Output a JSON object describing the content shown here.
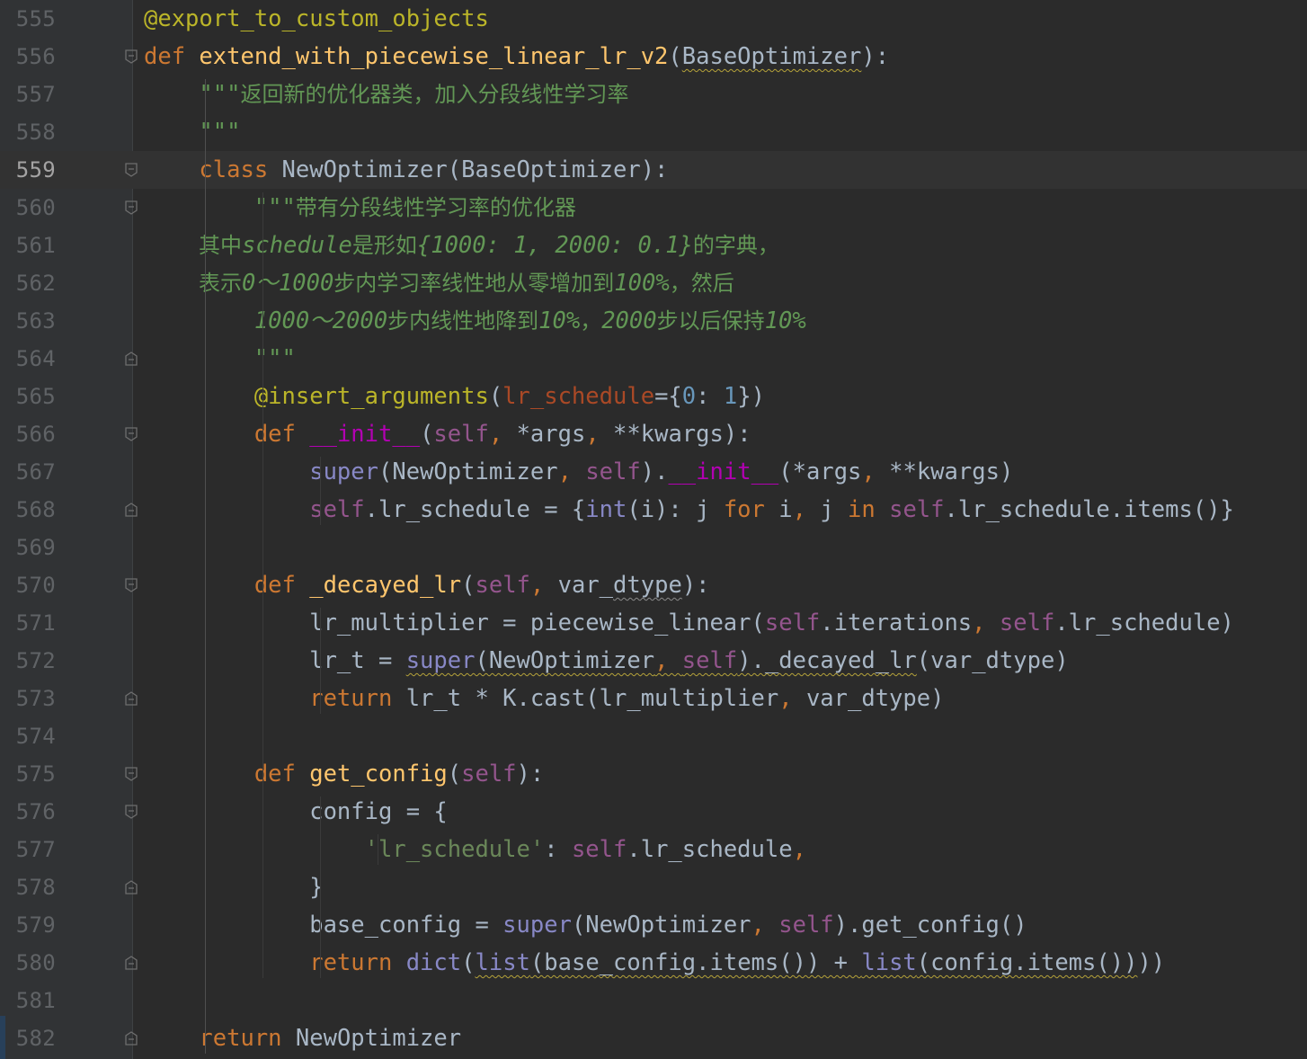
{
  "editor": {
    "language": "python",
    "current_line": 559,
    "colors": {
      "background": "#2b2b2b",
      "gutter": "#313335",
      "keyword": "#cc7832",
      "function": "#ffc66d",
      "decorator": "#bbb529",
      "self": "#94558d",
      "builtin": "#8888c6",
      "number": "#6897bb",
      "string": "#6a8759",
      "docstring": "#629755"
    }
  },
  "lines": [
    {
      "n": "555",
      "tokens": [
        [
          "dec",
          "@export_to_custom_objects"
        ]
      ]
    },
    {
      "n": "556",
      "tokens": [
        [
          "kw",
          "def "
        ],
        [
          "fn",
          "extend_with_piecewise_linear_lr_v2"
        ],
        [
          "",
          "("
        ],
        [
          "wavy",
          "BaseOptimizer"
        ],
        [
          "",
          "):"
        ]
      ]
    },
    {
      "n": "557",
      "tokens": [
        [
          "doc",
          "    \"\"\""
        ],
        [
          "doc-cn",
          "返回新的优化器类，加入分段线性学习率"
        ]
      ]
    },
    {
      "n": "558",
      "tokens": [
        [
          "doc",
          "    \"\"\""
        ]
      ]
    },
    {
      "n": "559",
      "tokens": [
        [
          "kw",
          "    class "
        ],
        [
          "",
          "NewOptimizer(BaseOptimizer):"
        ]
      ]
    },
    {
      "n": "560",
      "tokens": [
        [
          "doc",
          "        \"\"\""
        ],
        [
          "doc-cn",
          "带有分段线性学习率的优化器"
        ]
      ]
    },
    {
      "n": "561",
      "tokens": [
        [
          "doc-cn",
          "        其中"
        ],
        [
          "doc-it",
          "schedule"
        ],
        [
          "doc-cn",
          "是形如"
        ],
        [
          "doc-it",
          "{1000: 1, 2000: 0.1}"
        ],
        [
          "doc-cn",
          "的字典，"
        ]
      ]
    },
    {
      "n": "562",
      "tokens": [
        [
          "doc-cn",
          "        表示"
        ],
        [
          "doc-it",
          "0～1000"
        ],
        [
          "doc-cn",
          "步内学习率线性地从零增加到"
        ],
        [
          "doc-it",
          "100%"
        ],
        [
          "doc-cn",
          "，然后"
        ]
      ]
    },
    {
      "n": "563",
      "tokens": [
        [
          "doc-it",
          "        1000～2000"
        ],
        [
          "doc-cn",
          "步内线性地降到"
        ],
        [
          "doc-it",
          "10%"
        ],
        [
          "doc-cn",
          "，"
        ],
        [
          "doc-it",
          "2000"
        ],
        [
          "doc-cn",
          "步以后保持"
        ],
        [
          "doc-it",
          "10%"
        ]
      ]
    },
    {
      "n": "564",
      "tokens": [
        [
          "doc",
          "        \"\"\""
        ]
      ]
    },
    {
      "n": "565",
      "tokens": [
        [
          "dec",
          "        @insert_arguments"
        ],
        [
          "",
          "("
        ],
        [
          "param",
          "lr_schedule"
        ],
        [
          "",
          "={"
        ],
        [
          "num",
          "0"
        ],
        [
          "",
          ": "
        ],
        [
          "num",
          "1"
        ],
        [
          "",
          "})"
        ]
      ]
    },
    {
      "n": "566",
      "tokens": [
        [
          "kw",
          "        def "
        ],
        [
          "magic",
          "__init__"
        ],
        [
          "",
          "("
        ],
        [
          "self",
          "self"
        ],
        [
          "kw",
          ", "
        ],
        [
          "",
          "*args"
        ],
        [
          "kw",
          ", "
        ],
        [
          "",
          "**kwargs):"
        ]
      ]
    },
    {
      "n": "567",
      "tokens": [
        [
          "bi",
          "            super"
        ],
        [
          "",
          "(NewOptimizer"
        ],
        [
          "kw",
          ", "
        ],
        [
          "self",
          "self"
        ],
        [
          "",
          ")."
        ],
        [
          "magic",
          "__init__"
        ],
        [
          "",
          "(*args"
        ],
        [
          "kw",
          ", "
        ],
        [
          "",
          "**kwargs)"
        ]
      ]
    },
    {
      "n": "568",
      "tokens": [
        [
          "self",
          "            self"
        ],
        [
          "",
          ".lr_schedule = {"
        ],
        [
          "bi",
          "int"
        ],
        [
          "",
          "(i): j "
        ],
        [
          "kw",
          "for "
        ],
        [
          "",
          "i"
        ],
        [
          "kw",
          ", "
        ],
        [
          "",
          "j "
        ],
        [
          "kw",
          "in "
        ],
        [
          "self",
          "self"
        ],
        [
          "",
          ".lr_schedule.items()}"
        ]
      ]
    },
    {
      "n": "569",
      "tokens": []
    },
    {
      "n": "570",
      "tokens": [
        [
          "kw",
          "        def "
        ],
        [
          "fn",
          "_decayed_lr"
        ],
        [
          "",
          "("
        ],
        [
          "self",
          "self"
        ],
        [
          "kw",
          ", "
        ],
        [
          "",
          "var_"
        ],
        [
          "wavy-grey",
          "dtype"
        ],
        [
          "",
          "):"
        ]
      ]
    },
    {
      "n": "571",
      "tokens": [
        [
          "",
          "            lr_multiplier = piecewise_linear("
        ],
        [
          "self",
          "self"
        ],
        [
          "",
          ".iterations"
        ],
        [
          "kw",
          ", "
        ],
        [
          "self",
          "self"
        ],
        [
          "",
          ".lr_schedule)"
        ]
      ]
    },
    {
      "n": "572",
      "tokens": [
        [
          "",
          "            lr_t = "
        ],
        [
          "wavy bi",
          "super"
        ],
        [
          "wavy",
          "(NewOptimizer"
        ],
        [
          "wavy kw",
          ", "
        ],
        [
          "wavy self",
          "self"
        ],
        [
          "wavy",
          ")._decayed_lr"
        ],
        [
          "",
          "(var_dtype)"
        ]
      ]
    },
    {
      "n": "573",
      "tokens": [
        [
          "kw",
          "            return "
        ],
        [
          "",
          "lr_t * K.cast(lr_multiplier"
        ],
        [
          "kw",
          ", "
        ],
        [
          "",
          "var_dtype)"
        ]
      ]
    },
    {
      "n": "574",
      "tokens": []
    },
    {
      "n": "575",
      "tokens": [
        [
          "kw",
          "        def "
        ],
        [
          "fn",
          "get_config"
        ],
        [
          "",
          "("
        ],
        [
          "self",
          "self"
        ],
        [
          "",
          "):"
        ]
      ]
    },
    {
      "n": "576",
      "tokens": [
        [
          "",
          "            config = {"
        ]
      ]
    },
    {
      "n": "577",
      "tokens": [
        [
          "str",
          "                'lr_schedule'"
        ],
        [
          "",
          ": "
        ],
        [
          "self",
          "self"
        ],
        [
          "",
          ".lr_schedule"
        ],
        [
          "kw",
          ","
        ]
      ]
    },
    {
      "n": "578",
      "tokens": [
        [
          "",
          "            }"
        ]
      ]
    },
    {
      "n": "579",
      "tokens": [
        [
          "",
          "            base_config = "
        ],
        [
          "bi",
          "super"
        ],
        [
          "",
          "(NewOptimizer"
        ],
        [
          "kw",
          ", "
        ],
        [
          "self",
          "self"
        ],
        [
          "",
          ").get_config()"
        ]
      ]
    },
    {
      "n": "580",
      "tokens": [
        [
          "kw",
          "            return "
        ],
        [
          "bi",
          "dict"
        ],
        [
          "",
          "("
        ],
        [
          "wavy bi",
          "list"
        ],
        [
          "wavy",
          "(base_config.items()) + "
        ],
        [
          "wavy bi",
          "list"
        ],
        [
          "wavy",
          "(config.items())"
        ],
        [
          "",
          "))"
        ]
      ]
    },
    {
      "n": "581",
      "tokens": []
    },
    {
      "n": "582",
      "tokens": [
        [
          "kw",
          "    return "
        ],
        [
          "",
          "NewOptimizer"
        ]
      ]
    }
  ],
  "folds": {
    "556": "open",
    "559": "open",
    "560": "open",
    "564": "close",
    "566": "open",
    "568": "close",
    "570": "open",
    "573": "close",
    "575": "open",
    "576": "open",
    "578": "close",
    "580": "close",
    "582": "close"
  }
}
